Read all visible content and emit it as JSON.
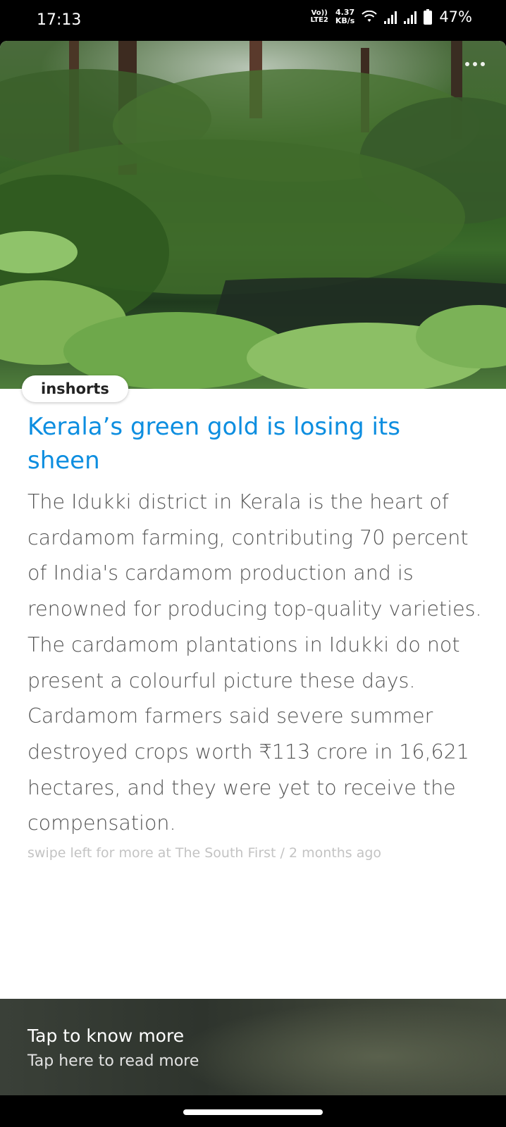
{
  "status_bar": {
    "time": "17:13",
    "volte_top": "Vo))",
    "volte_bottom": "LTE2",
    "net_speed_value": "4.37",
    "net_speed_unit": "KB/s",
    "battery_percent": "47%"
  },
  "article": {
    "brand": "inshorts",
    "title": "Kerala’s green gold is losing its sheen",
    "body": "The Idukki district in Kerala is the heart of cardamom farming, contributing 70 percent of India's cardamom production and is renowned for producing top-quality varieties. The cardamom plantations in Idukki do not present a colourful picture these days. Cardamom farmers said severe summer destroyed crops worth ₹113 crore in 16,621 hectares, and they were yet to receive the compensation.",
    "source_line": "swipe left for more at The South First / 2 months ago"
  },
  "footer": {
    "title": "Tap to know more",
    "subtitle": "Tap here to read more"
  },
  "icons": [
    "wifi-icon",
    "signal-icon",
    "battery-icon",
    "more-options-icon"
  ]
}
